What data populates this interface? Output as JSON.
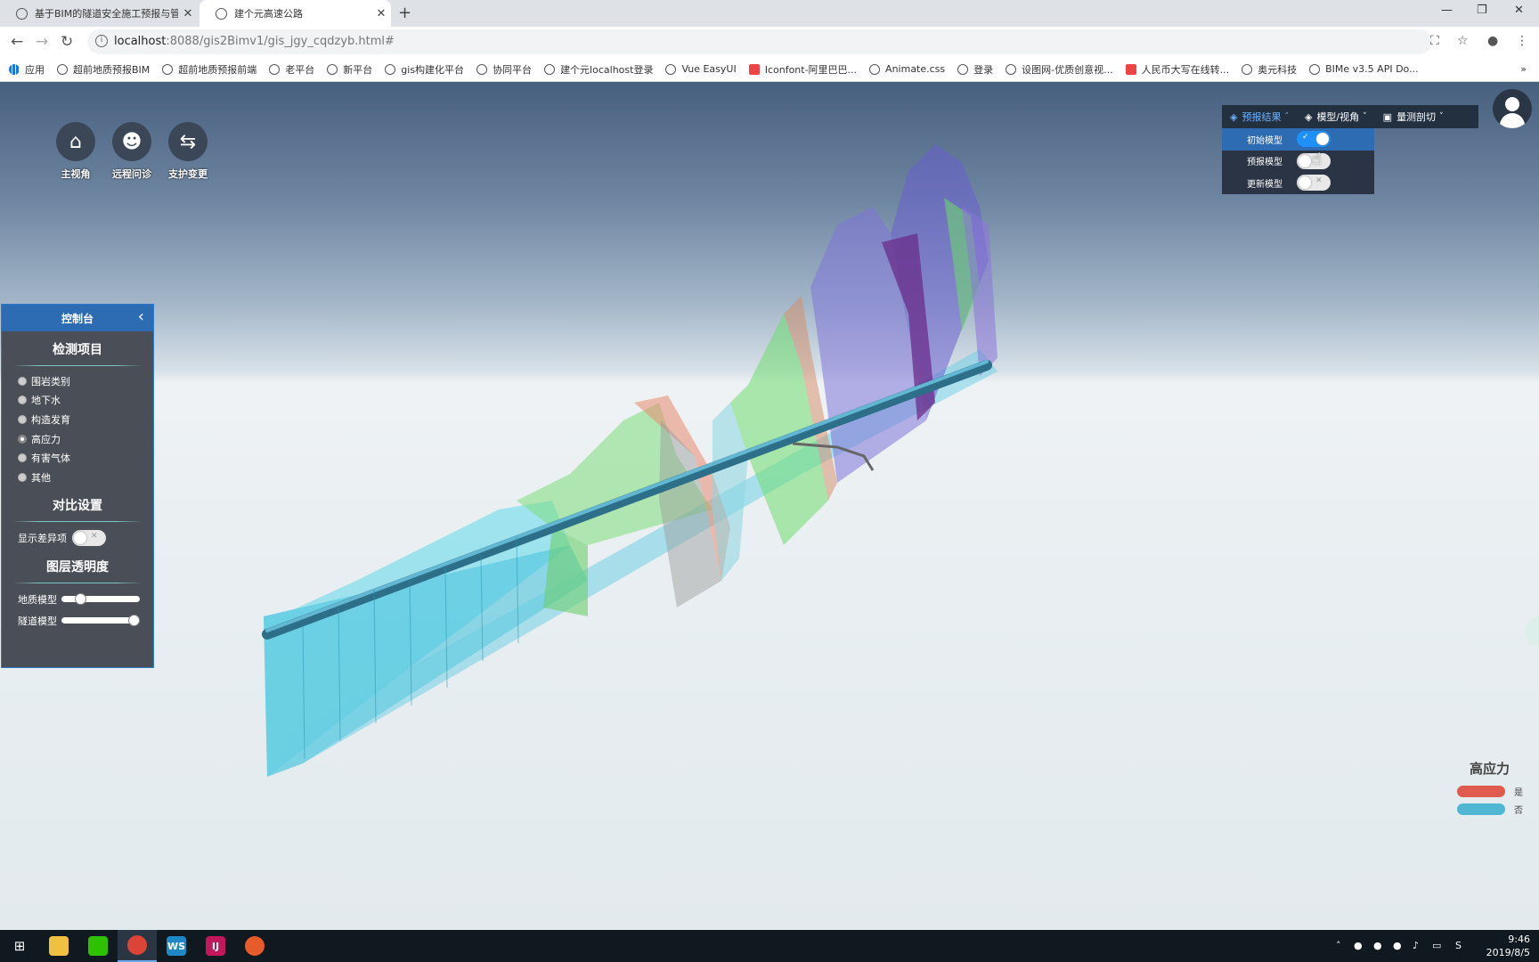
{
  "browser": {
    "tabs": [
      {
        "title": "基于BIM的隧道安全施工预报与管"
      },
      {
        "title": "建个元高速公路"
      }
    ],
    "url_host": "localhost",
    "url_rest": ":8088/gis2Bimv1/gis_jgy_cqdzyb.html#",
    "bookmarks": [
      {
        "label": "应用"
      },
      {
        "label": "超前地质预报BIM"
      },
      {
        "label": "超前地质预报前端"
      },
      {
        "label": "老平台"
      },
      {
        "label": "新平台"
      },
      {
        "label": "gis构建化平台"
      },
      {
        "label": "协同平台"
      },
      {
        "label": "建个元localhost登录"
      },
      {
        "label": "Vue EasyUI"
      },
      {
        "label": "Iconfont-阿里巴巴..."
      },
      {
        "label": "Animate.css"
      },
      {
        "label": "登录"
      },
      {
        "label": "设图网-优质创意视..."
      },
      {
        "label": "人民币大写在线转..."
      },
      {
        "label": "奥元科技"
      },
      {
        "label": "BIMe v3.5 API Do..."
      }
    ],
    "more": "»"
  },
  "toolbar": {
    "buttons": [
      {
        "label": "主视角",
        "icon": "home-icon"
      },
      {
        "label": "远程问诊",
        "icon": "consult-icon"
      },
      {
        "label": "支护变更",
        "icon": "swap-icon"
      }
    ]
  },
  "topmenu": {
    "items": [
      {
        "label": "预报结果",
        "icon": "layers-icon"
      },
      {
        "label": "模型/视角",
        "icon": "layers-icon"
      },
      {
        "label": "量测剖切",
        "icon": "toolbox-icon"
      }
    ]
  },
  "dropdown": {
    "rows": [
      {
        "label": "初始模型",
        "on": true
      },
      {
        "label": "预报模型",
        "on": false
      },
      {
        "label": "更新模型",
        "on": false
      }
    ]
  },
  "console": {
    "title": "控制台",
    "section1": "检测项目",
    "items": [
      "围岩类别",
      "地下水",
      "构造发育",
      "高应力",
      "有害气体",
      "其他"
    ],
    "selected": "高应力",
    "section2": "对比设置",
    "diff_label": "显示差异项",
    "section3": "图层透明度",
    "sliders": [
      {
        "label": "地质模型",
        "value": 0.2
      },
      {
        "label": "隧道模型",
        "value": 1.0
      }
    ]
  },
  "legend": {
    "title": "高应力",
    "items": [
      {
        "label": "是",
        "color": "#e05a4e"
      },
      {
        "label": "否",
        "color": "#4fb6d4"
      }
    ]
  },
  "taskbar": {
    "time": "9:46",
    "date": "2019/8/5"
  }
}
